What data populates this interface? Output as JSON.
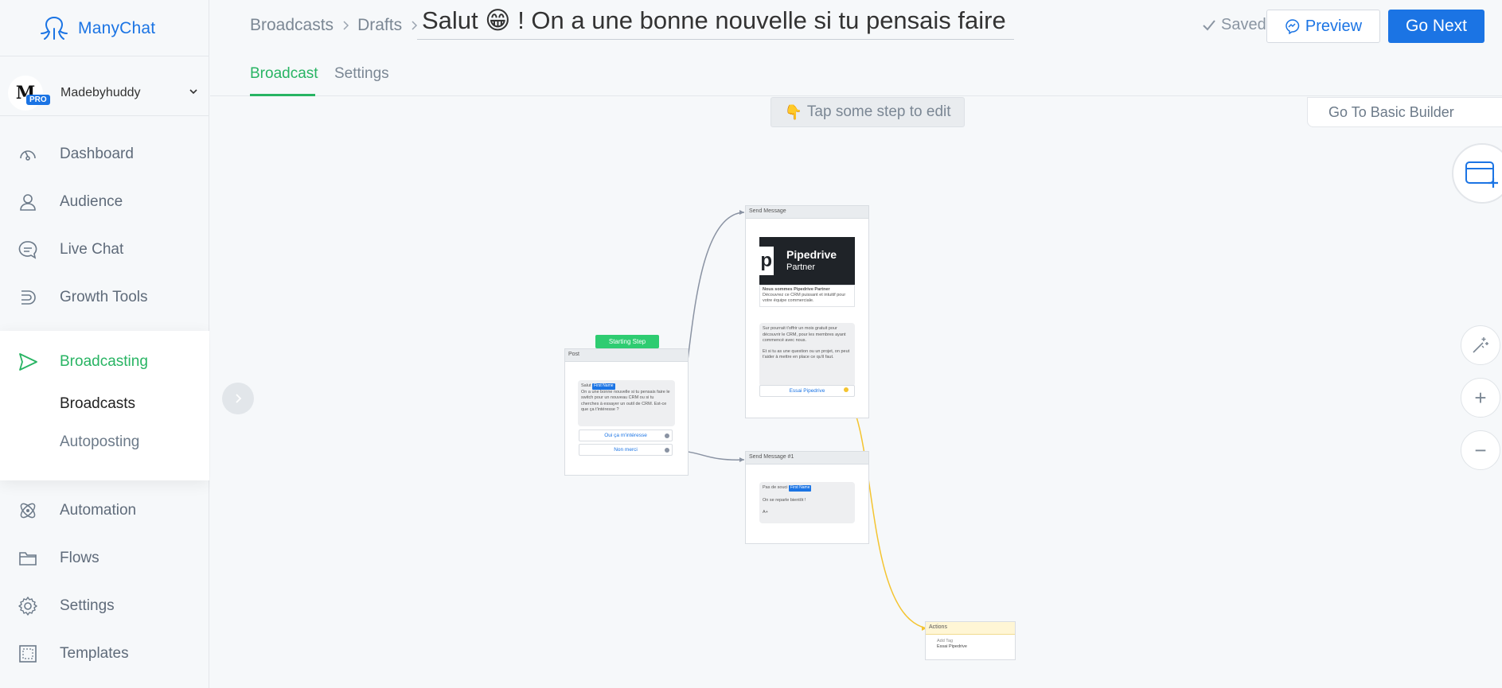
{
  "app": {
    "brand": "ManyChat"
  },
  "account": {
    "initial": "M",
    "badge": "PRO",
    "name": "Madebyhuddy"
  },
  "nav": {
    "items": [
      {
        "label": "Dashboard"
      },
      {
        "label": "Audience"
      },
      {
        "label": "Live Chat"
      },
      {
        "label": "Growth Tools"
      },
      {
        "label": "Broadcasting"
      },
      {
        "label": "Automation"
      },
      {
        "label": "Flows"
      },
      {
        "label": "Settings"
      },
      {
        "label": "Templates"
      }
    ],
    "broadcasting_sub": [
      {
        "label": "Broadcasts"
      },
      {
        "label": "Autoposting"
      }
    ]
  },
  "header": {
    "breadcrumbs": [
      {
        "label": "Broadcasts"
      },
      {
        "label": "Drafts"
      }
    ],
    "title": "Salut 😁 ! On a une bonne nouvelle si tu pensais faire l...",
    "saved_label": "Saved",
    "preview_label": "Preview",
    "next_label": "Go Next",
    "tabs": [
      {
        "label": "Broadcast"
      },
      {
        "label": "Settings"
      }
    ]
  },
  "canvas": {
    "hint": "Tap some step to edit",
    "basic_builder": "Go To Basic Builder",
    "zoom_in": "+",
    "zoom_out": "−",
    "start_badge": "Starting Step",
    "post_node": {
      "title": "Post",
      "bubble_text": "On a une bonne nouvelle si tu pensais faire le switch pour un nouveau CRM ou si tu cherches à essayer un outil de CRM. Est-ce que ça t'intéresse ?",
      "greeting": "Salut",
      "chip": "First Name",
      "buttons": [
        "Oui ça m'intéresse",
        "Non merci"
      ]
    },
    "send_message_node": {
      "title": "Send Message",
      "card_title": "Pipedrive",
      "card_subtitle": "Partner",
      "card_caption": "Nous sommes Pipedrive Partner",
      "card_desc": "Découvrez ce CRM puissant et intuitif pour votre équipe commerciale.",
      "text_1": "Sur pourrait t'offrir un mois gratuit pour découvrir le CRM, pour les membres ayant commencé avec nous.",
      "text_2": "Et si tu as une question ou un projet, on peut t'aider à mettre en place ce qu'il faut.",
      "button": "Essai Pipedrive"
    },
    "send_message_1_node": {
      "title": "Send Message #1",
      "greeting": "Pas de souci",
      "chip": "First Name",
      "line_1": "On se reparle bientôt !",
      "line_2": "A+"
    },
    "actions_node": {
      "title": "Actions",
      "line_1": "Add Tag",
      "line_2": "Essai Pipedrive"
    }
  },
  "colors": {
    "accent_blue": "#1b74e4",
    "accent_green": "#28b463",
    "start_green": "#2ecc71",
    "connector_yellow": "#f4c430"
  }
}
